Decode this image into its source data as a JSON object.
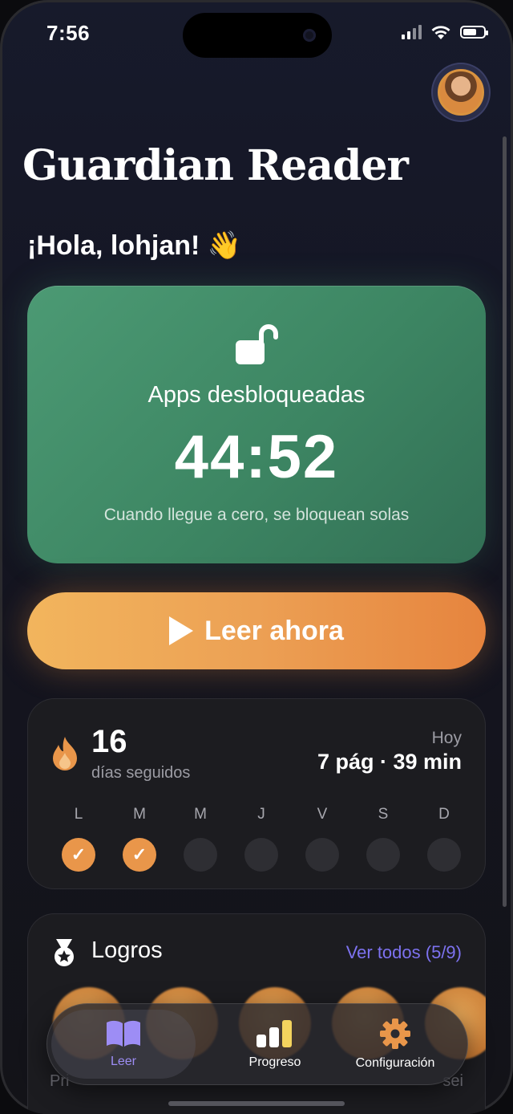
{
  "status_bar": {
    "time": "7:56"
  },
  "header": {
    "title": "Guardian Reader",
    "greeting": "¡Hola, lohjan! 👋"
  },
  "unlock_card": {
    "label": "Apps desbloqueadas",
    "countdown": "44:52",
    "note": "Cuando llegue a cero, se bloquean solas",
    "icon": "unlocked-padlock-icon",
    "color": "#3d8663"
  },
  "read_button": {
    "label": "Leer ahora",
    "icon": "play-icon",
    "color": "#eca054"
  },
  "streak": {
    "count": "16",
    "unit_label": "días seguidos",
    "today_label": "Hoy",
    "today_stats": "7 pág · 39 min",
    "days": [
      {
        "letter": "L",
        "done": true
      },
      {
        "letter": "M",
        "done": true
      },
      {
        "letter": "M",
        "done": false
      },
      {
        "letter": "J",
        "done": false
      },
      {
        "letter": "V",
        "done": false
      },
      {
        "letter": "S",
        "done": false
      },
      {
        "letter": "D",
        "done": false
      }
    ],
    "check_glyph": "✓"
  },
  "achievements": {
    "title": "Logros",
    "view_all": "Ver todos (5/9)",
    "caption_left": "Pri",
    "caption_right": "sei"
  },
  "tabbar": {
    "tabs": [
      {
        "label": "Leer",
        "icon": "book-icon",
        "active": true
      },
      {
        "label": "Progreso",
        "icon": "bar-chart-icon",
        "active": false
      },
      {
        "label": "Configuración",
        "icon": "gear-icon",
        "active": false
      }
    ],
    "active_color": "#9d8df5"
  }
}
